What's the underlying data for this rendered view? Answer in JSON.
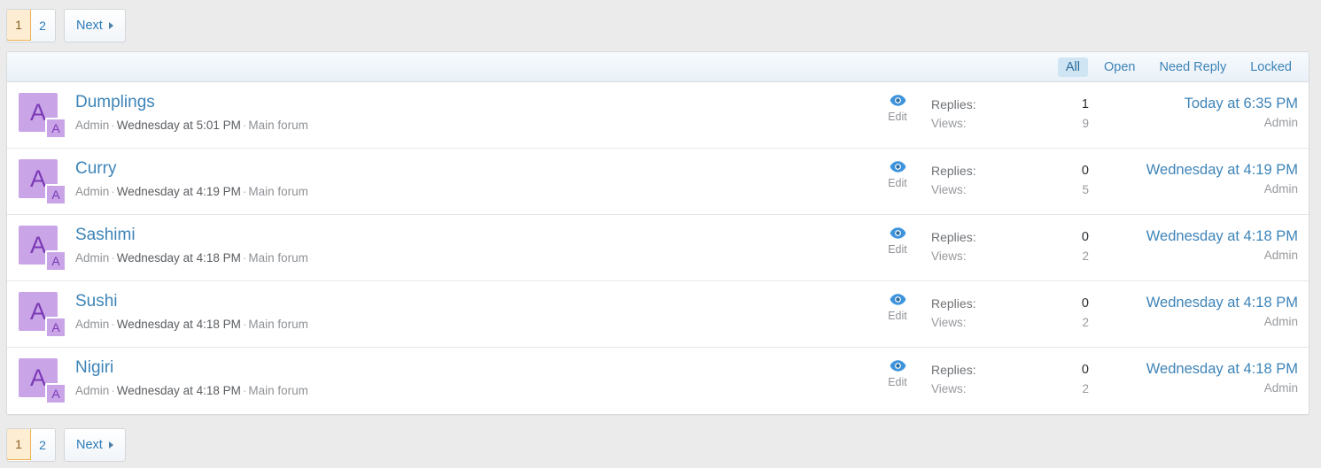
{
  "pagination": {
    "pages": [
      {
        "label": "1",
        "current": true
      },
      {
        "label": "2",
        "current": false
      }
    ],
    "next_label": "Next"
  },
  "filter_tabs": [
    {
      "label": "All",
      "active": true
    },
    {
      "label": "Open",
      "active": false
    },
    {
      "label": "Need Reply",
      "active": false
    },
    {
      "label": "Locked",
      "active": false
    }
  ],
  "labels": {
    "replies": "Replies:",
    "views": "Views:",
    "edit": "Edit",
    "avatar_letter": "A",
    "meta_separator": "·"
  },
  "colors": {
    "link": "#3d84b8",
    "avatar_bg": "#c9a5e8",
    "avatar_fg": "#7b39b5",
    "active_page_bg": "#fdeed3",
    "active_page_border": "#eeb151",
    "active_tab_bg": "#cfe5f3",
    "eye_icon": "#3d94dd",
    "page_bg": "#ebebeb"
  },
  "threads": [
    {
      "title": "Dumplings",
      "author": "Admin",
      "date": "Wednesday at 5:01 PM",
      "node": "Main forum",
      "replies": "1",
      "views": "9",
      "last_date": "Today at 6:35 PM",
      "last_user": "Admin"
    },
    {
      "title": "Curry",
      "author": "Admin",
      "date": "Wednesday at 4:19 PM",
      "node": "Main forum",
      "replies": "0",
      "views": "5",
      "last_date": "Wednesday at 4:19 PM",
      "last_user": "Admin"
    },
    {
      "title": "Sashimi",
      "author": "Admin",
      "date": "Wednesday at 4:18 PM",
      "node": "Main forum",
      "replies": "0",
      "views": "2",
      "last_date": "Wednesday at 4:18 PM",
      "last_user": "Admin"
    },
    {
      "title": "Sushi",
      "author": "Admin",
      "date": "Wednesday at 4:18 PM",
      "node": "Main forum",
      "replies": "0",
      "views": "2",
      "last_date": "Wednesday at 4:18 PM",
      "last_user": "Admin"
    },
    {
      "title": "Nigiri",
      "author": "Admin",
      "date": "Wednesday at 4:18 PM",
      "node": "Main forum",
      "replies": "0",
      "views": "2",
      "last_date": "Wednesday at 4:18 PM",
      "last_user": "Admin"
    }
  ]
}
